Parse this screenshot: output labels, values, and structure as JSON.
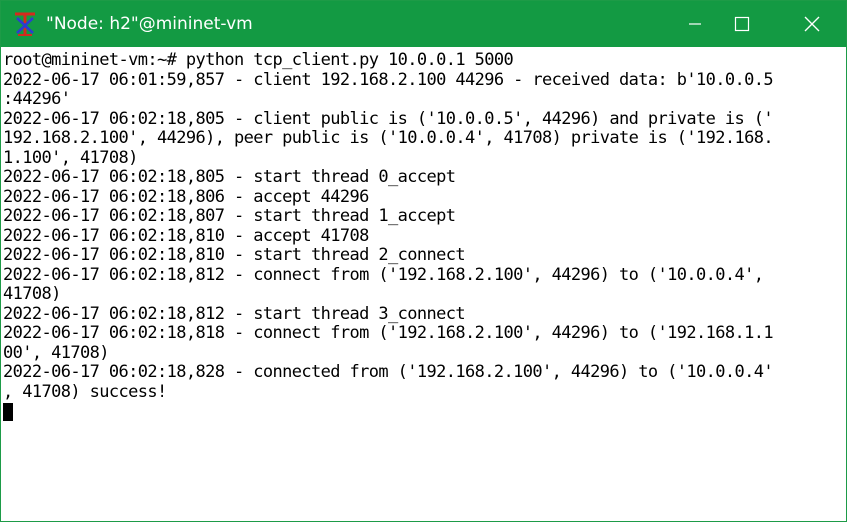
{
  "window": {
    "title": "\"Node: h2\"@mininet-vm",
    "icon": "x11-terminal-icon",
    "titlebar_color": "#139a43",
    "controls": {
      "minimize_icon": "minimize-icon",
      "maximize_icon": "maximize-icon",
      "close_icon": "close-icon"
    }
  },
  "terminal": {
    "lines": [
      "root@mininet-vm:~# python tcp_client.py 10.0.0.1 5000",
      "2022-06-17 06:01:59,857 - client 192.168.2.100 44296 - received data: b'10.0.0.5",
      ":44296'",
      "2022-06-17 06:02:18,805 - client public is ('10.0.0.5', 44296) and private is ('",
      "192.168.2.100', 44296), peer public is ('10.0.0.4', 41708) private is ('192.168.",
      "1.100', 41708)",
      "2022-06-17 06:02:18,805 - start thread 0_accept",
      "2022-06-17 06:02:18,806 - accept 44296",
      "2022-06-17 06:02:18,807 - start thread 1_accept",
      "2022-06-17 06:02:18,810 - accept 41708",
      "2022-06-17 06:02:18,810 - start thread 2_connect",
      "2022-06-17 06:02:18,812 - connect from ('192.168.2.100', 44296) to ('10.0.0.4',",
      "41708)",
      "2022-06-17 06:02:18,812 - start thread 3_connect",
      "2022-06-17 06:02:18,818 - connect from ('192.168.2.100', 44296) to ('192.168.1.1",
      "00', 41708)",
      "2022-06-17 06:02:18,828 - connected from ('192.168.2.100', 44296) to ('10.0.0.4'",
      ", 41708) success!"
    ]
  }
}
